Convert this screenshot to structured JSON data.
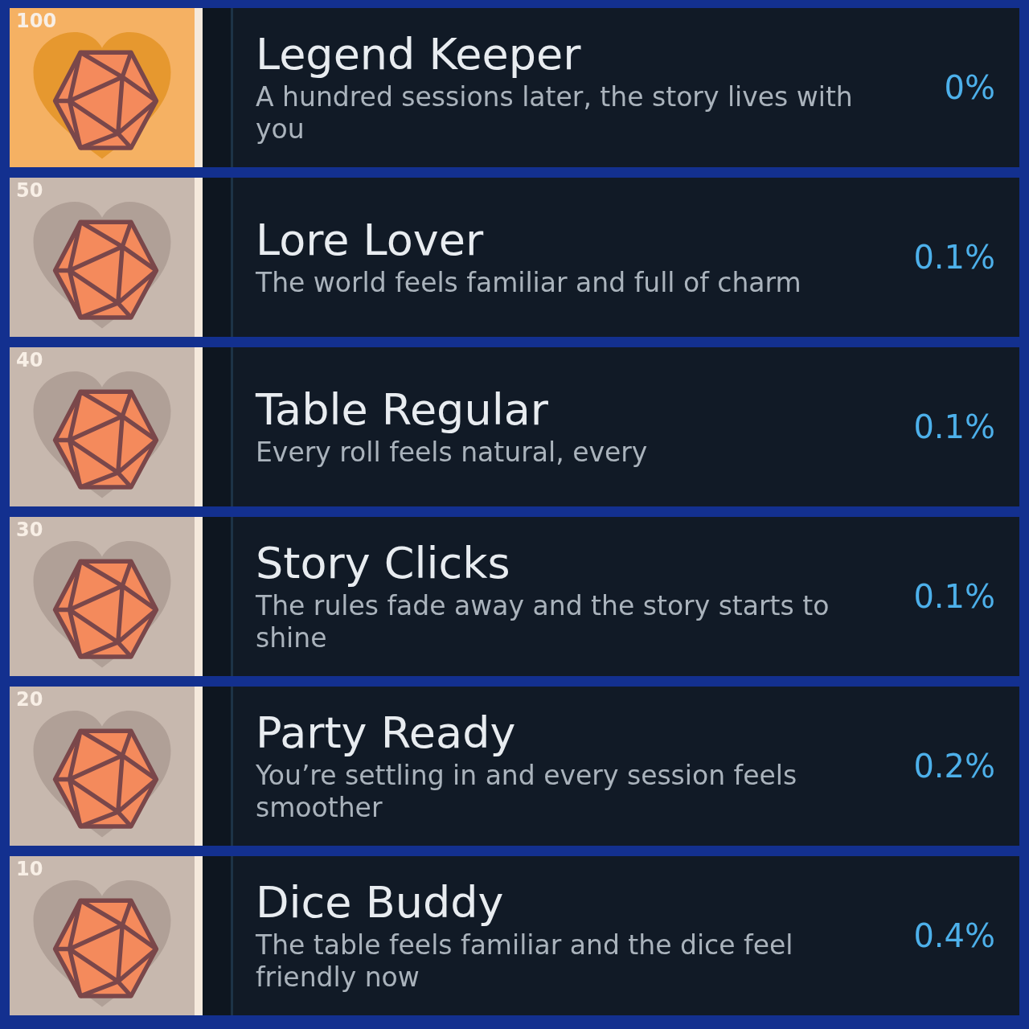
{
  "achievements": [
    {
      "badge": "100",
      "title": "Legend Keeper",
      "description": "A hundred sessions later, the story lives with you",
      "percent": "0%",
      "highlighted": true
    },
    {
      "badge": "50",
      "title": "Lore Lover",
      "description": "The world feels familiar and full of charm",
      "percent": "0.1%",
      "highlighted": false
    },
    {
      "badge": "40",
      "title": "Table Regular",
      "description": "Every roll feels natural, every",
      "percent": "0.1%",
      "highlighted": false
    },
    {
      "badge": "30",
      "title": "Story Clicks",
      "description": "The rules fade away and the story starts to shine",
      "percent": "0.1%",
      "highlighted": false
    },
    {
      "badge": "20",
      "title": "Party Ready",
      "description": "You’re settling in and every session feels smoother",
      "percent": "0.2%",
      "highlighted": false
    },
    {
      "badge": "10",
      "title": "Dice Buddy",
      "description": "The table feels familiar and the dice feel friendly now",
      "percent": "0.4%",
      "highlighted": false
    }
  ]
}
